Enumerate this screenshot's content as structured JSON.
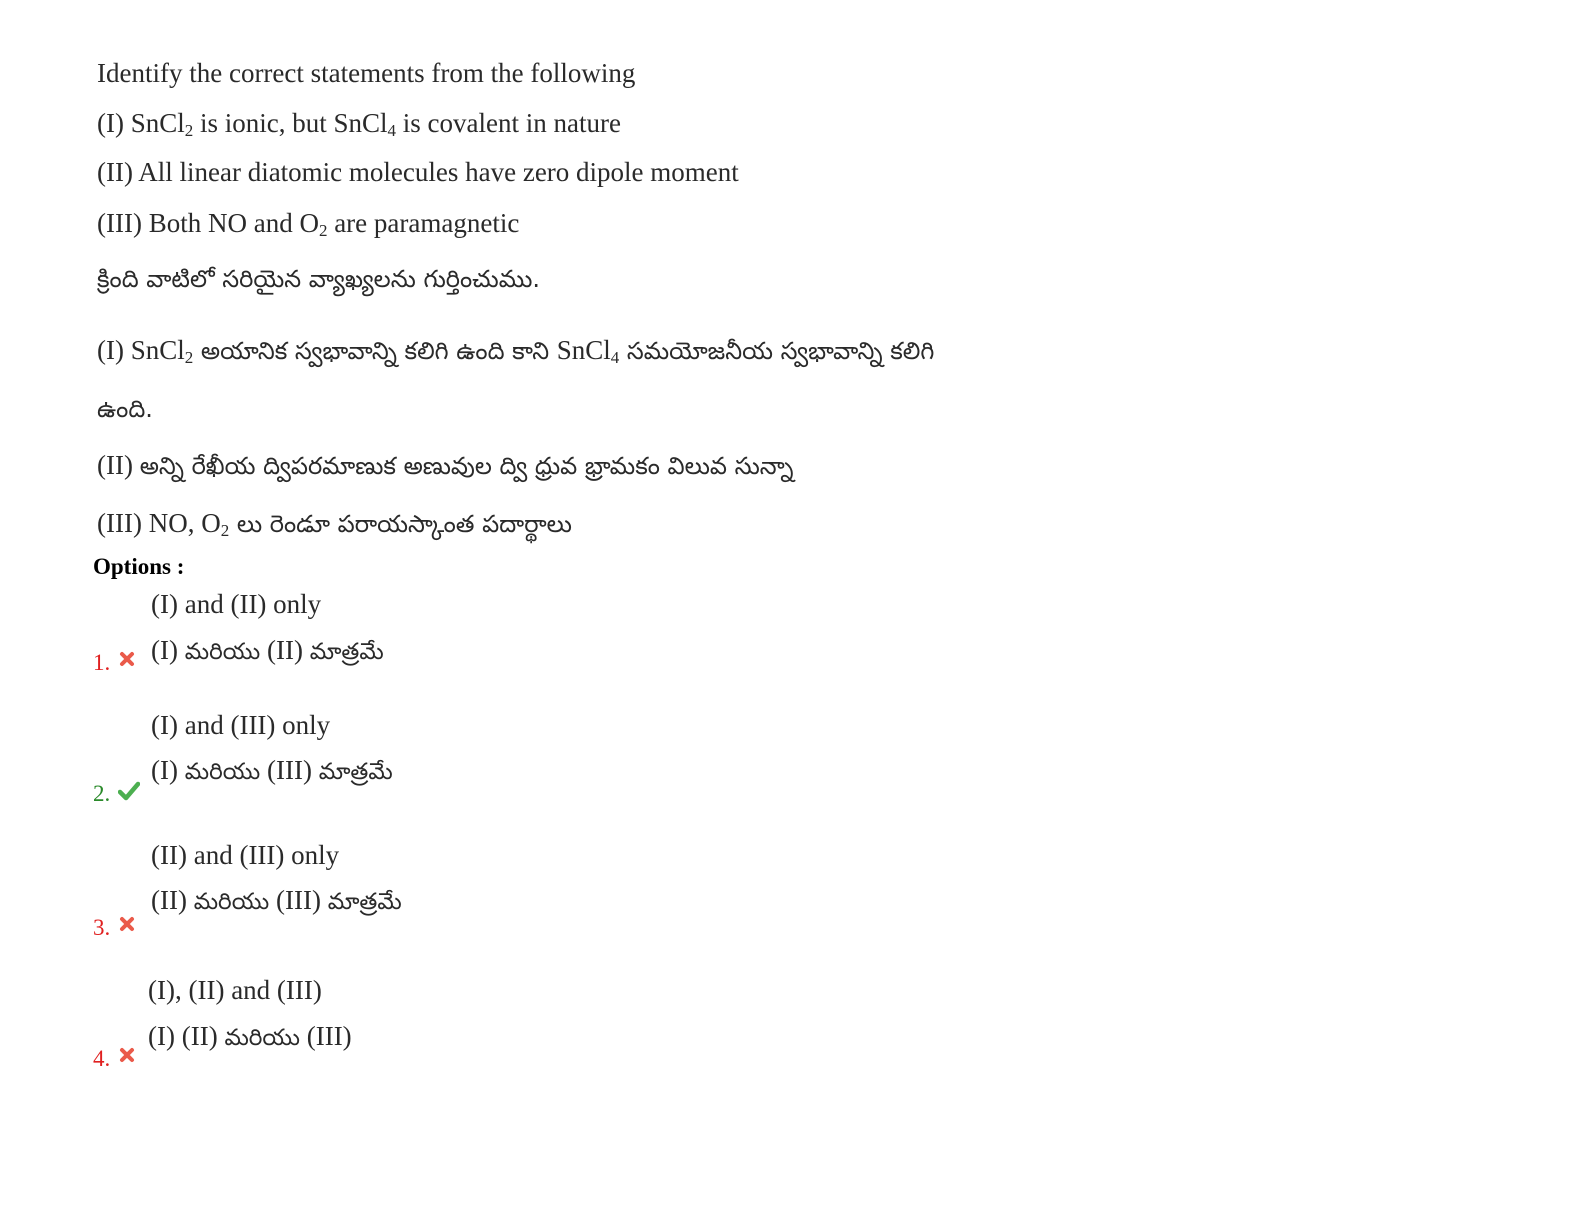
{
  "question": {
    "en_prompt": "Identify the correct statements from the following",
    "stmt1_a": "(I) SnCl",
    "stmt1_sub1": "2",
    "stmt1_b": " is ionic, but SnCl",
    "stmt1_sub2": "4",
    "stmt1_c": " is covalent in nature",
    "stmt2": "(II) All linear diatomic molecules have zero dipole moment",
    "stmt3_a": "(III) Both NO and O",
    "stmt3_sub": "2",
    "stmt3_b": " are paramagnetic",
    "te_prompt": "క్రింది వాటిలో సరియైన వ్యాఖ్యలను గుర్తించుము.",
    "te1_a": "(I) SnCl",
    "te1_sub1": "2",
    "te1_b": " అయానిక స్వభావాన్ని కలిగి ఉంది కాని ",
    "te1_c": "SnCl",
    "te1_sub2": "4",
    "te1_d": " సమయోజనీయ స్వభావాన్ని కలిగి",
    "te1_cont": "ఉంది.",
    "te2_a": "(II) ",
    "te2_b": "అన్ని రేఖీయ ద్విపరమాణుక అణువుల ద్వి ధ్రువ భ్రామకం విలువ సున్నా",
    "te3_a": "(III) NO, O",
    "te3_sub": "2",
    "te3_b": " లు రెండూ పరాయస్కాంత పదార్థాలు"
  },
  "options_label": "Options :",
  "options": [
    {
      "number": "1.",
      "en": "(I) and (II) only",
      "te_a": "(I)  ",
      "te_b": "మరియు",
      "te_c": "  (II) ",
      "te_d": "మాత్రమే",
      "status": "wrong"
    },
    {
      "number": "2.",
      "en": "(I) and (III) only",
      "te_a": "(I)  ",
      "te_b": "మరియు",
      "te_c": "  (III) ",
      "te_d": "మాత్రమే",
      "status": "correct"
    },
    {
      "number": "3.",
      "en": "(II) and (III) only",
      "te_a": "(II)  ",
      "te_b": "మరియు",
      "te_c": "  (III) ",
      "te_d": "మాత్రమే",
      "status": "wrong"
    },
    {
      "number": "4.",
      "en": "(I), (II) and (III)",
      "te_a": "(I)  (II) ",
      "te_b": "మరియు",
      "te_c": " (III)",
      "te_d": "",
      "status": "wrong"
    }
  ],
  "colors": {
    "wrong": "#e02020",
    "correct": "#2a8a2a",
    "cross_icon": "#ea5a4a",
    "check_icon": "#4caf50"
  }
}
